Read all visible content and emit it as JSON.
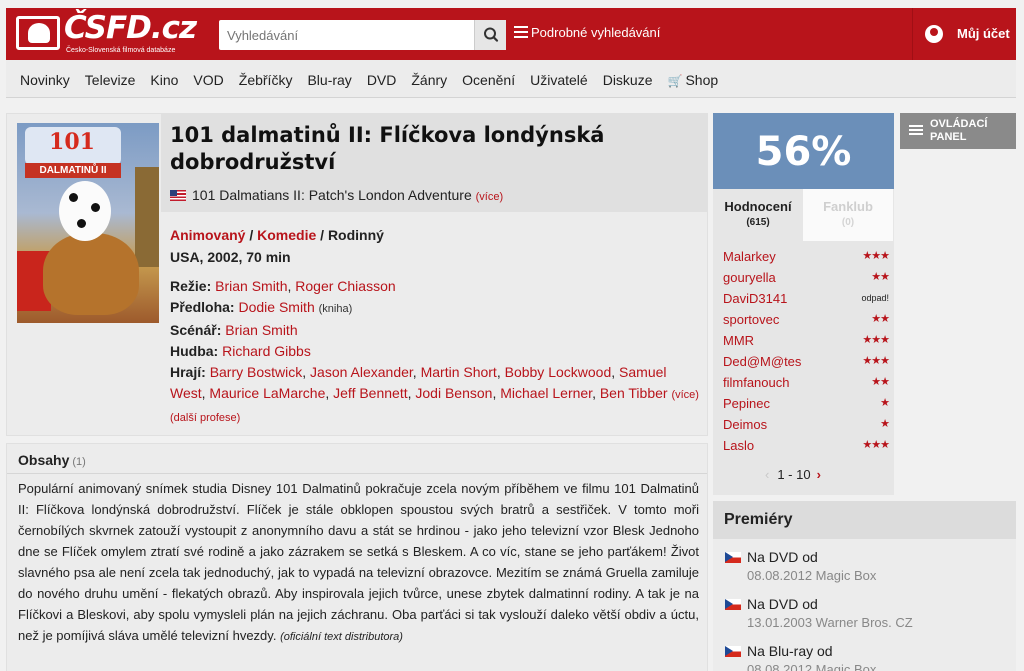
{
  "header": {
    "logo_text": "ČSFD.cz",
    "logo_tagline": "Česko-Slovenská filmová databáze",
    "search_placeholder": "Vyhledávání",
    "advanced_search": "Podrobné vyhledávání",
    "account": "Můj účet"
  },
  "nav": [
    {
      "label": "Novinky"
    },
    {
      "label": "Televize"
    },
    {
      "label": "Kino"
    },
    {
      "label": "VOD"
    },
    {
      "label": "Žebříčky"
    },
    {
      "label": "Blu-ray"
    },
    {
      "label": "DVD"
    },
    {
      "label": "Žánry"
    },
    {
      "label": "Ocenění"
    },
    {
      "label": "Uživatelé"
    },
    {
      "label": "Diskuze"
    },
    {
      "label": "Shop",
      "icon": "cart-icon"
    }
  ],
  "film": {
    "poster_title": "101",
    "poster_subtitle": "DALMATINŮ II",
    "title": "101 dalmatinů II: Flíčkova londýnská dobrodružství",
    "original_title": "101 Dalmatians II: Patch's London Adventure",
    "original_more": "(více)",
    "genres": [
      "Animovaný",
      "Komedie",
      "Rodinný"
    ],
    "origin": "USA, 2002, 70 min",
    "credits": {
      "directors_label": "Režie:",
      "directors": [
        "Brian Smith",
        "Roger Chiasson"
      ],
      "source_label": "Předloha:",
      "source": "Dodie Smith",
      "source_note": "(kniha)",
      "writer_label": "Scénář:",
      "writer": "Brian Smith",
      "music_label": "Hudba:",
      "music": "Richard Gibbs",
      "cast_label": "Hrají:",
      "cast": [
        "Barry Bostwick",
        "Jason Alexander",
        "Martin Short",
        "Bobby Lockwood",
        "Samuel West",
        "Maurice LaMarche",
        "Jeff Bennett",
        "Jodi Benson",
        "Michael Lerner",
        "Ben Tibber"
      ],
      "cast_more": "(více)",
      "more_professions": "(další profese)"
    }
  },
  "plot": {
    "heading": "Obsahy",
    "count": "(1)",
    "text": "Populární animovaný snímek studia Disney 101 Dalmatinů pokračuje zcela novým příběhem ve filmu 101 Dalmatinů II: Flíčkova londýnská dobrodružství. Flíček je stále obklopen spoustou svých bratrů a sestřiček. V tomto moři černobílých skvrnek zatouží vystoupit z anonymního davu a stát se hrdinou - jako jeho televizní vzor Blesk Jednoho dne se Flíček omylem ztratí své rodině a jako zázrakem se setká s Bleskem. A co víc, stane se jeho parťákem! Život slavného psa ale není zcela tak jednoduchý, jak to vypadá na televizní obrazovce. Mezitím se známá Gruella zamiluje do nového druhu umění - flekatých obrazů. Aby inspirovala jejich tvůrce, unese zbytek dalmatinní rodiny. A tak je na Flíčkovi a Bleskovi, aby spolu vymysleli plán na jejich záchranu. Oba parťáci si tak vyslouží daleko větší obdiv a úctu, než je pomíjivá sláva umělé televizní hvezdy.",
    "source": "(oficiální text distributora)"
  },
  "rating": {
    "score": "56%",
    "score_color": "#6b8fb9",
    "tab_ratings": "Hodnocení",
    "tab_ratings_count": "(615)",
    "tab_fanclub": "Fanklub",
    "tab_fanclub_count": "(0)",
    "users": [
      {
        "name": "Malarkey",
        "stars": "★★★"
      },
      {
        "name": "gouryella",
        "stars": "★★"
      },
      {
        "name": "DaviD3141",
        "stars": "",
        "note": "odpad!"
      },
      {
        "name": "sportovec",
        "stars": "★★"
      },
      {
        "name": "MMR",
        "stars": "★★★"
      },
      {
        "name": "Ded@M@tes",
        "stars": "★★★"
      },
      {
        "name": "filmfanouch",
        "stars": "★★"
      },
      {
        "name": "Pepinec",
        "stars": "★"
      },
      {
        "name": "Deimos",
        "stars": "★"
      },
      {
        "name": "Laslo",
        "stars": "★★★"
      }
    ],
    "pager": "1 - 10"
  },
  "control_panel": {
    "line1": "OVLÁDACÍ",
    "line2": "PANEL"
  },
  "premieres": {
    "heading": "Premiéry",
    "items": [
      {
        "label": "Na DVD od",
        "detail": "08.08.2012 Magic Box"
      },
      {
        "label": "Na DVD od",
        "detail": "13.01.2003 Warner Bros. CZ"
      },
      {
        "label": "Na Blu-ray od",
        "detail": "08.08.2012 Magic Box"
      }
    ]
  },
  "colors": {
    "brand": "#b8141b",
    "score_bg": "#6b8fb9"
  }
}
